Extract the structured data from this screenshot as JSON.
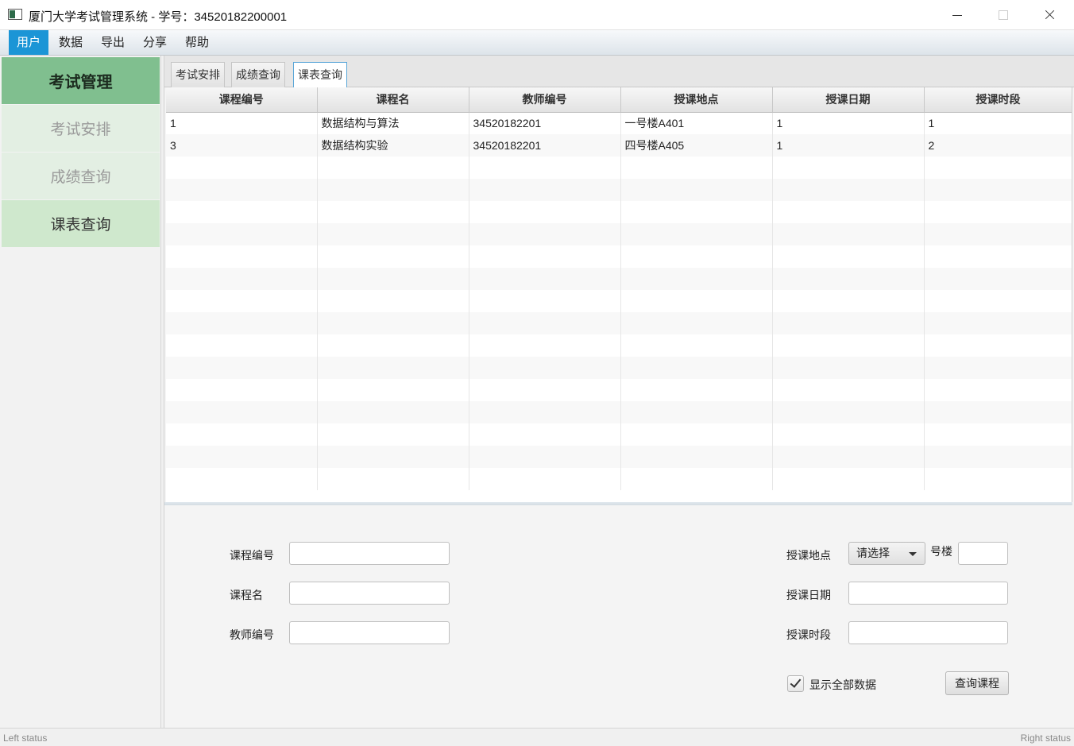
{
  "window": {
    "title": "厦门大学考试管理系统 - 学号：34520182200001"
  },
  "menu": {
    "items": [
      "用户",
      "数据",
      "导出",
      "分享",
      "帮助"
    ],
    "active_index": 0
  },
  "sidebar": {
    "header": "考试管理",
    "items": [
      "考试安排",
      "成绩查询",
      "课表查询"
    ],
    "selected_index": 2
  },
  "tabs": {
    "items": [
      "考试安排",
      "成绩查询",
      "课表查询"
    ],
    "active_index": 2
  },
  "table": {
    "columns": [
      "课程编号",
      "课程名",
      "教师编号",
      "授课地点",
      "授课日期",
      "授课时段"
    ],
    "rows": [
      [
        "1",
        "数据结构与算法",
        "34520182201",
        "一号楼A401",
        "1",
        "1"
      ],
      [
        "3",
        "数据结构实验",
        "34520182201",
        "四号楼A405",
        "1",
        "2"
      ]
    ]
  },
  "form": {
    "course_id_label": "课程编号",
    "course_id_value": "",
    "course_name_label": "课程名",
    "course_name_value": "",
    "teacher_id_label": "教师编号",
    "teacher_id_value": "",
    "location_label": "授课地点",
    "location_select_value": "请选择",
    "building_suffix": "号楼",
    "room_value": "",
    "date_label": "授课日期",
    "date_value": "",
    "period_label": "授课时段",
    "period_value": "",
    "show_all_label": "显示全部数据",
    "show_all_checked": true,
    "query_button": "查询课程"
  },
  "status": {
    "left": "Left status",
    "right": "Right status"
  }
}
